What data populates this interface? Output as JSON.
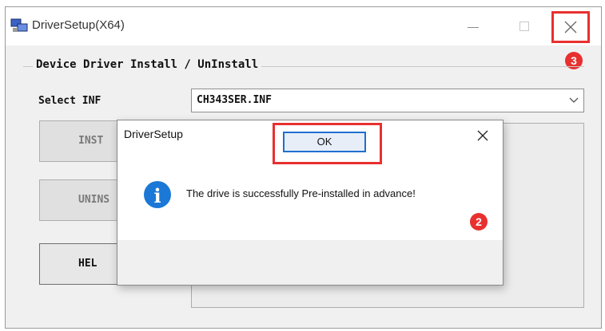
{
  "window": {
    "title": "DriverSetup(X64)",
    "group_title": "Device Driver Install / UnInstall",
    "select_label": "Select INF",
    "inf_value": "CH343SER.INF",
    "buttons": {
      "install": "INST",
      "uninstall": "UNINS",
      "help": "HEL"
    }
  },
  "dialog": {
    "title": "DriverSetup",
    "message": "The drive is successfully Pre-installed in advance!",
    "ok_label": "OK"
  },
  "annotations": {
    "close_step": "3",
    "ok_step": "2"
  },
  "colors": {
    "highlight": "#e8302f",
    "info_icon": "#1b78d6",
    "ok_border": "#1f6fd0"
  },
  "icons": {
    "app": "driver-setup-icon",
    "info": "info-icon",
    "close": "close-icon",
    "dropdown": "chevron-down-icon"
  }
}
